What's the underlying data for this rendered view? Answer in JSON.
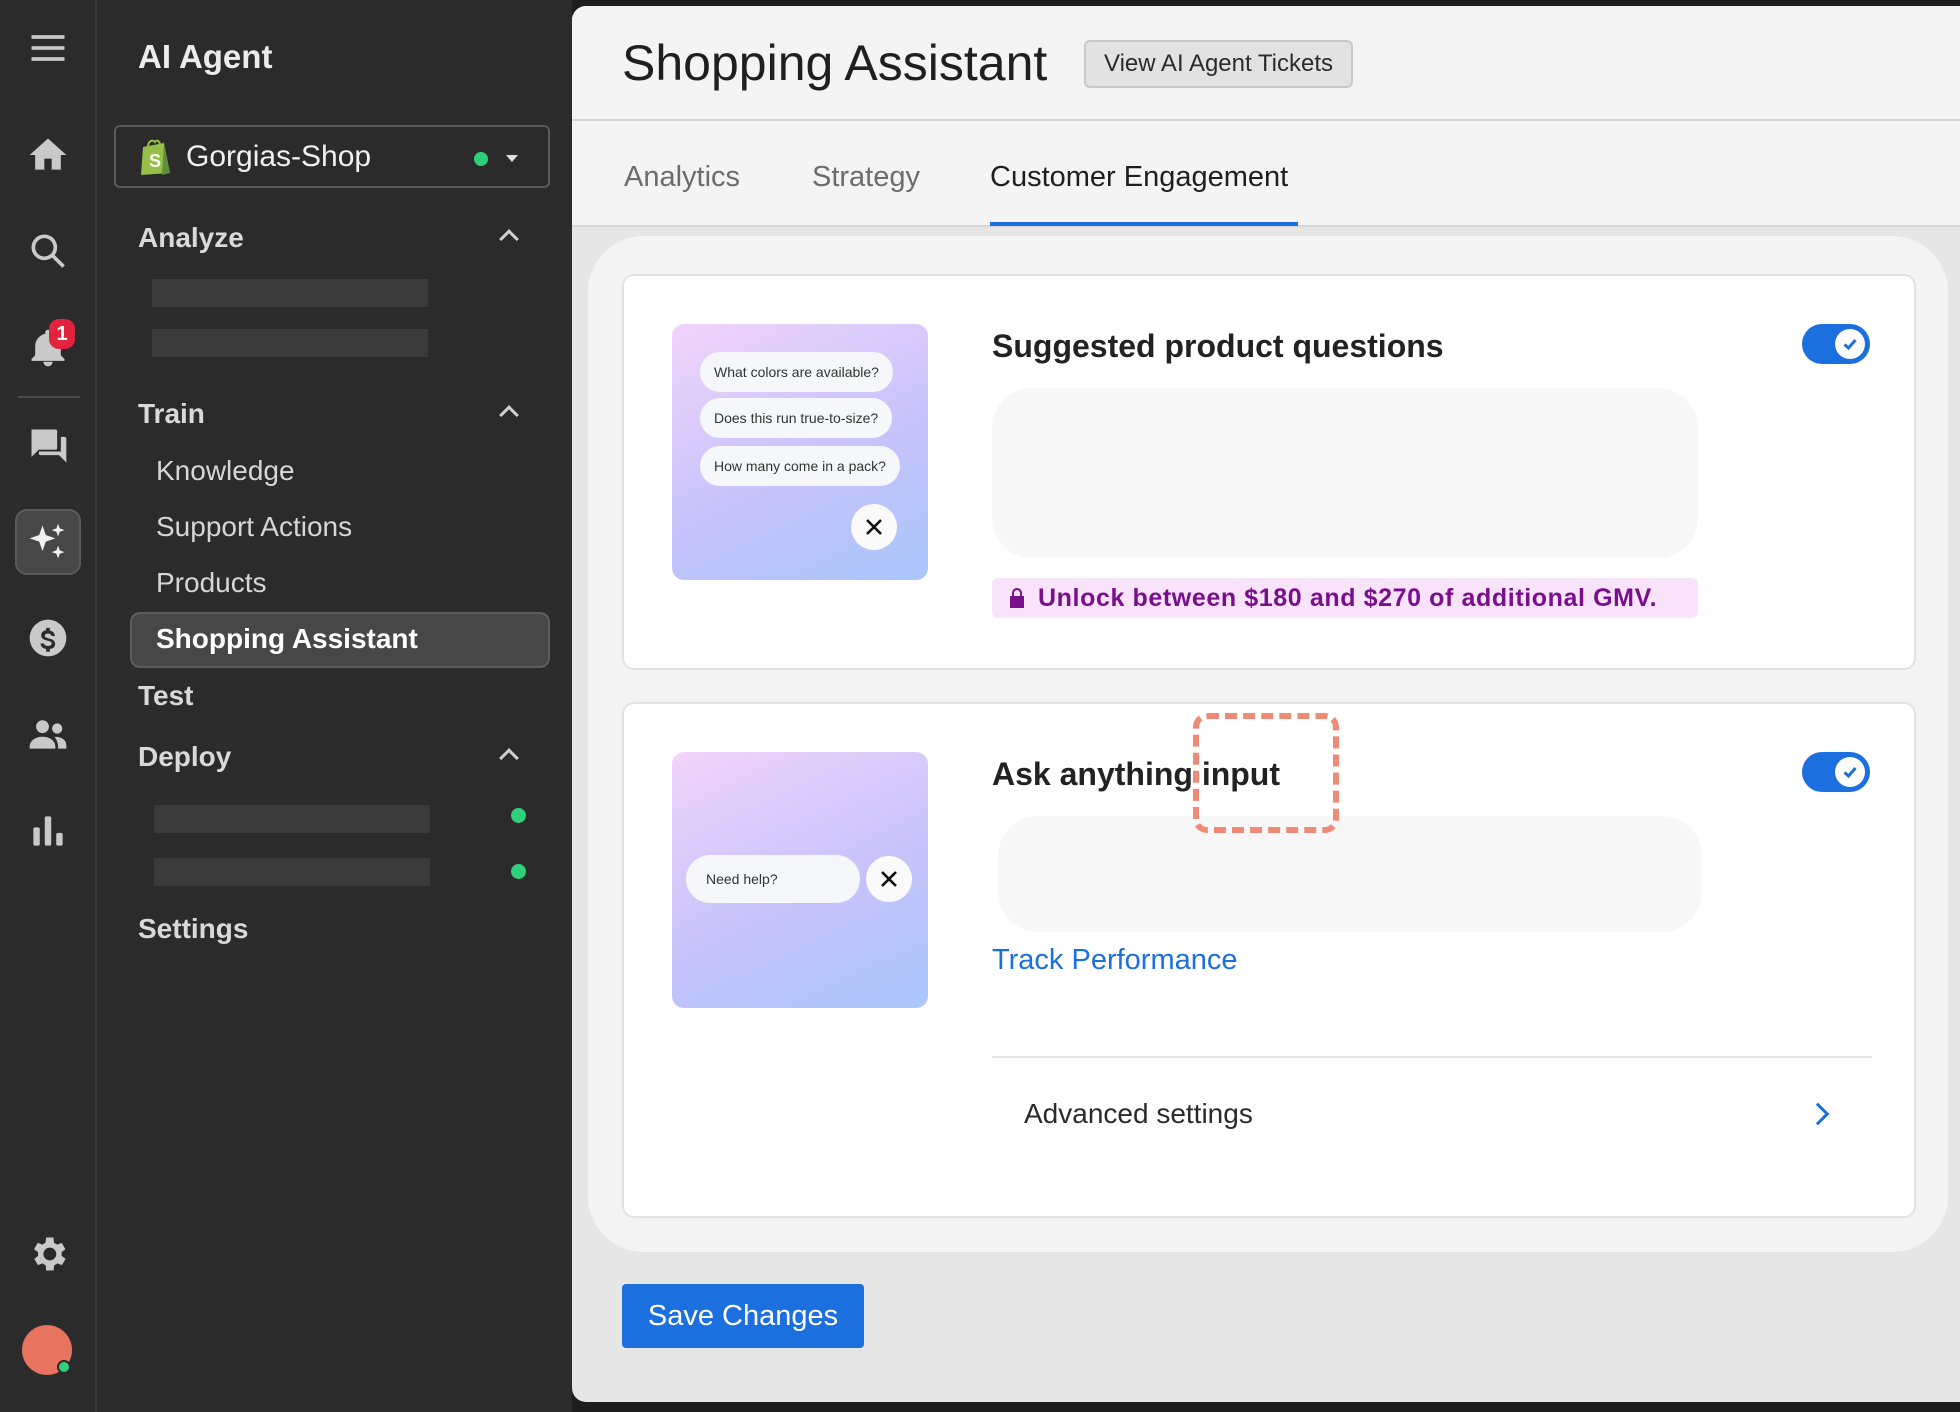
{
  "rail": {
    "icons": [
      "menu-icon",
      "home-icon",
      "search-icon",
      "bell-icon",
      "chat-icon",
      "sparkles-icon",
      "dollar-icon",
      "users-icon",
      "bar-chart-icon",
      "gear-icon"
    ],
    "notification_count": "1"
  },
  "nav": {
    "title": "AI Agent",
    "store": {
      "name": "Gorgias-Shop",
      "status_color": "#2fd07c"
    },
    "sections": {
      "analyze": "Analyze",
      "train": "Train",
      "test": "Test",
      "deploy": "Deploy",
      "settings": "Settings"
    },
    "train_items": [
      "Knowledge",
      "Support Actions",
      "Products",
      "Shopping Assistant"
    ],
    "active_item": "Shopping Assistant"
  },
  "header": {
    "title": "Shopping Assistant",
    "tickets_button": "View AI Agent Tickets"
  },
  "tabs": [
    {
      "label": "Analytics",
      "active": false
    },
    {
      "label": "Strategy",
      "active": false
    },
    {
      "label": "Customer Engagement",
      "active": true
    }
  ],
  "cards": {
    "suggested": {
      "title": "Suggested product questions",
      "enabled": true,
      "preview_chips": [
        "What colors are available?",
        "Does this run true-to-size?",
        "How many come in a pack?"
      ],
      "banner": "Unlock between $180 and $270 of additional GMV."
    },
    "ask_anything": {
      "title": "Ask anything input",
      "enabled": true,
      "preview_chip": "Need help?",
      "link": "Track Performance",
      "advanced": "Advanced settings"
    }
  },
  "footer": {
    "save_button": "Save Changes"
  },
  "colors": {
    "accent": "#1b6fde",
    "banner_text": "#7a0f8d",
    "highlight": "#ef8a78"
  }
}
